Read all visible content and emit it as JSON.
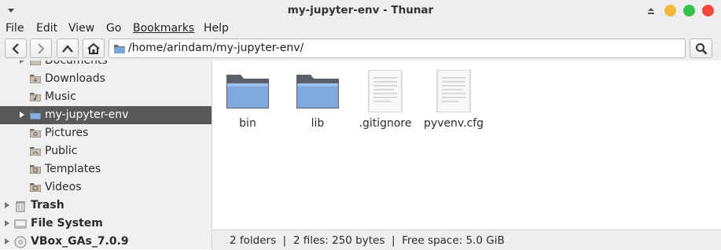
{
  "window": {
    "title": "my-jupyter-env - Thunar"
  },
  "menu": [
    "File",
    "Edit",
    "View",
    "Go",
    "Bookmarks",
    "Help"
  ],
  "location": {
    "path": "/home/arindam/my-jupyter-env/"
  },
  "sidebar": {
    "items": [
      {
        "label": "Documents"
      },
      {
        "label": "Downloads"
      },
      {
        "label": "Music"
      },
      {
        "label": "my-jupyter-env"
      },
      {
        "label": "Pictures"
      },
      {
        "label": "Public"
      },
      {
        "label": "Templates"
      },
      {
        "label": "Videos"
      },
      {
        "label": "Trash"
      },
      {
        "label": "File System"
      },
      {
        "label": "VBox_GAs_7.0.9"
      }
    ]
  },
  "files": [
    {
      "name": "bin",
      "type": "folder"
    },
    {
      "name": "lib",
      "type": "folder"
    },
    {
      "name": ".gitignore",
      "type": "text-file"
    },
    {
      "name": "pyvenv.cfg",
      "type": "text-file"
    }
  ],
  "status": {
    "text": "2 folders  |  2 files: 250 bytes  |  Free space: 5.0 GiB"
  },
  "colors": {
    "selection": "#595959",
    "window_min": "#f3b73b",
    "window_max": "#35c24a",
    "window_close": "#f2483d"
  }
}
